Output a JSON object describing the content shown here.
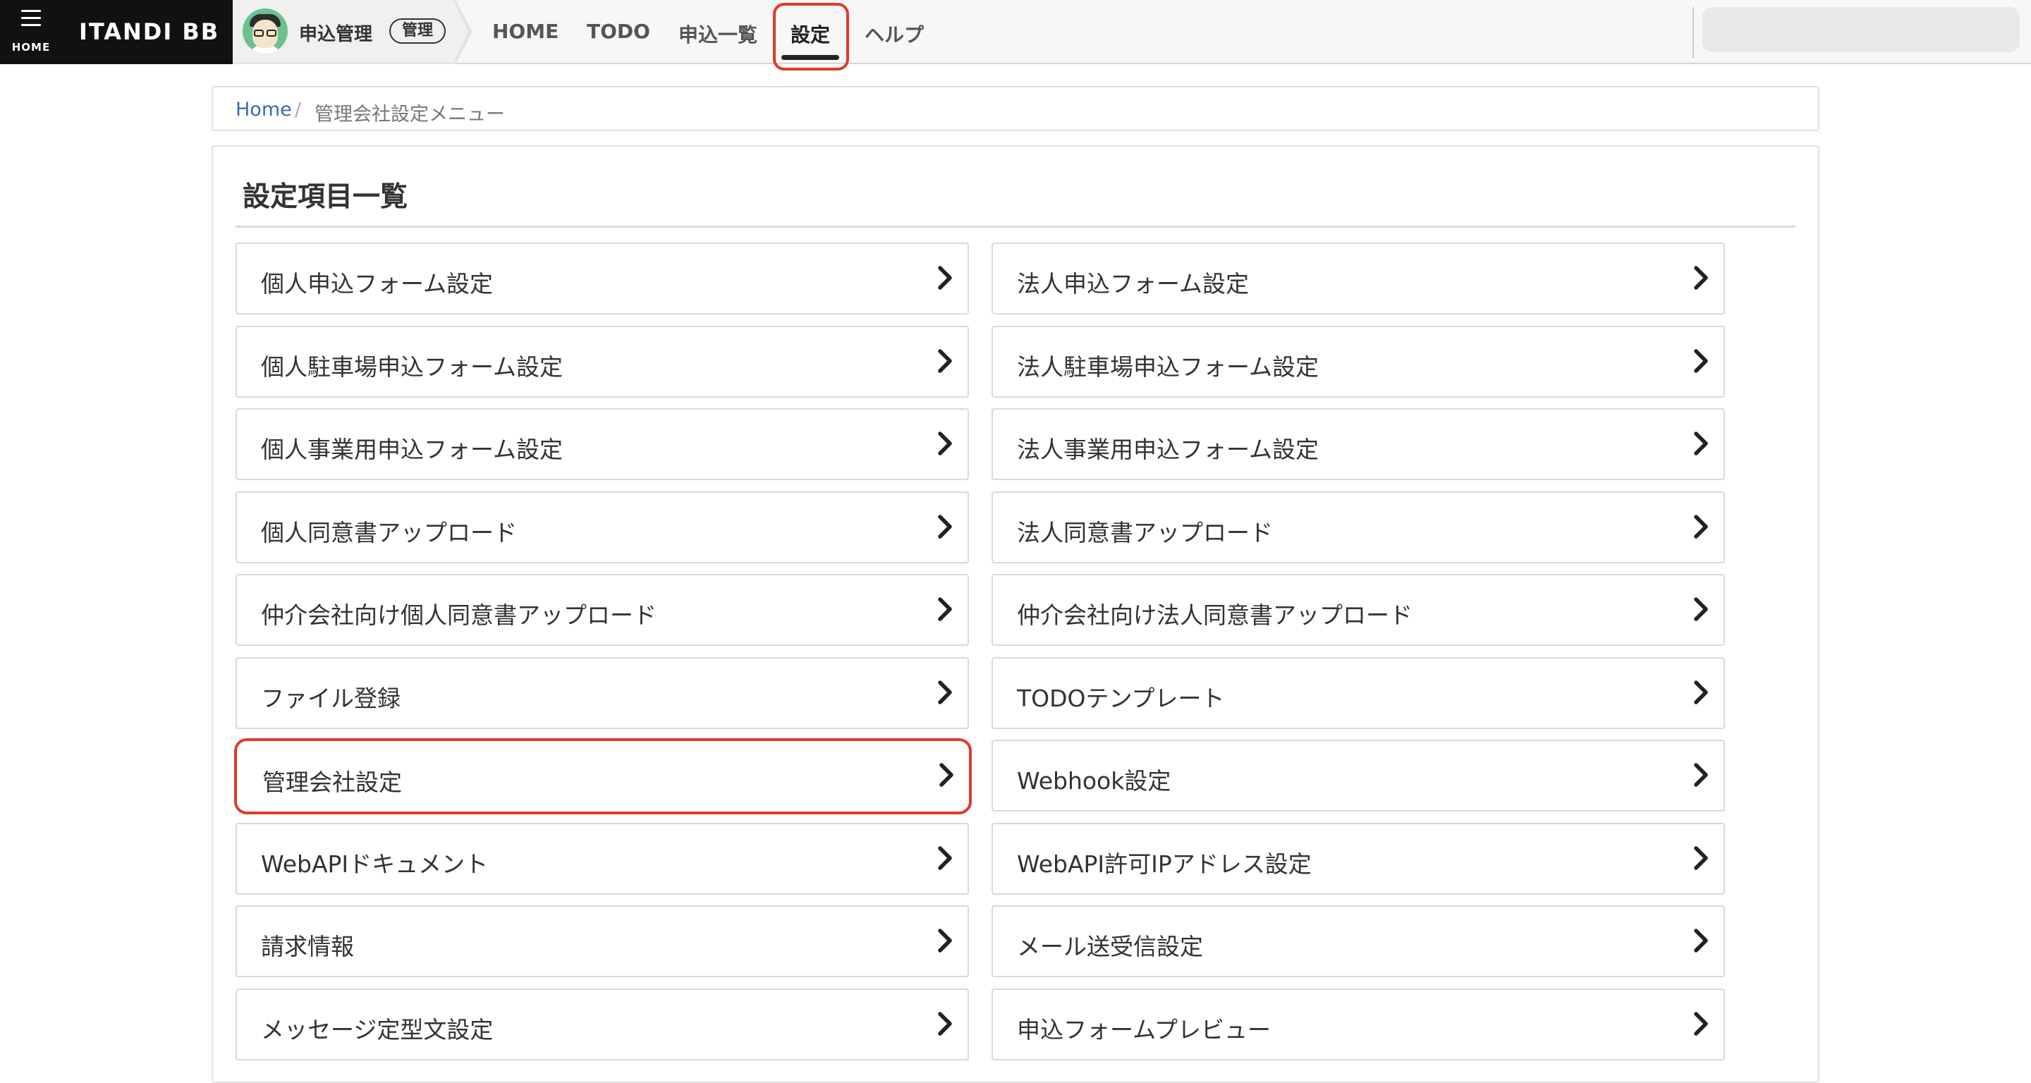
{
  "header": {
    "home_label": "HOME",
    "brand": "ITANDI BB",
    "app_name": "申込管理",
    "app_badge": "管理",
    "nav": [
      {
        "label": "HOME",
        "active": false
      },
      {
        "label": "TODO",
        "active": false
      },
      {
        "label": "申込一覧",
        "active": false
      },
      {
        "label": "設定",
        "active": true
      },
      {
        "label": "ヘルプ",
        "active": false
      }
    ]
  },
  "breadcrumb": {
    "home": "Home",
    "separator": "/",
    "current": "管理会社設定メニュー"
  },
  "panel": {
    "title": "設定項目一覧",
    "items_left": [
      {
        "label": "個人申込フォーム設定"
      },
      {
        "label": "個人駐車場申込フォーム設定"
      },
      {
        "label": "個人事業用申込フォーム設定"
      },
      {
        "label": "個人同意書アップロード"
      },
      {
        "label": "仲介会社向け個人同意書アップロード"
      },
      {
        "label": "ファイル登録"
      },
      {
        "label": "管理会社設定",
        "highlighted": true
      },
      {
        "label": "WebAPIドキュメント"
      },
      {
        "label": "請求情報"
      },
      {
        "label": "メッセージ定型文設定"
      }
    ],
    "items_right": [
      {
        "label": "法人申込フォーム設定"
      },
      {
        "label": "法人駐車場申込フォーム設定"
      },
      {
        "label": "法人事業用申込フォーム設定"
      },
      {
        "label": "法人同意書アップロード"
      },
      {
        "label": "仲介会社向け法人同意書アップロード"
      },
      {
        "label": "TODOテンプレート"
      },
      {
        "label": "Webhook設定"
      },
      {
        "label": "WebAPI許可IPアドレス設定"
      },
      {
        "label": "メール送受信設定"
      },
      {
        "label": "申込フォームプレビュー"
      }
    ]
  },
  "colors": {
    "highlight": "#e03b2c",
    "link": "#3a6ca8",
    "brand_bg": "#111111"
  },
  "icons": {
    "menu": "hamburger-icon",
    "tile_arrow": "chevron-right-icon"
  }
}
